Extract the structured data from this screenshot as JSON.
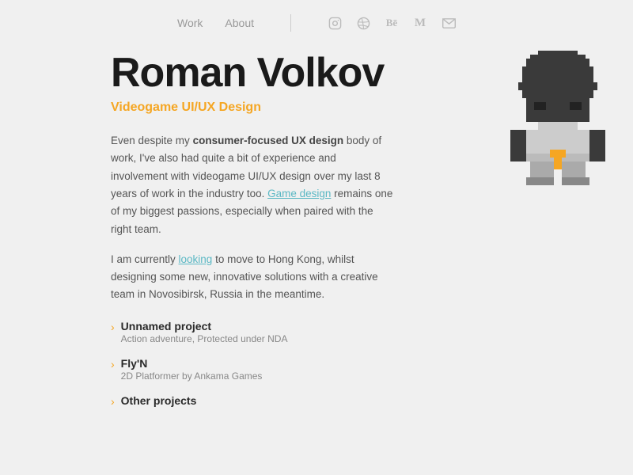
{
  "nav": {
    "links": [
      {
        "label": "Work",
        "id": "work"
      },
      {
        "label": "About",
        "id": "about"
      }
    ],
    "icons": [
      {
        "name": "instagram-icon",
        "symbol": "◯"
      },
      {
        "name": "dribbble-icon",
        "symbol": "◉"
      },
      {
        "name": "behance-icon",
        "symbol": "Bē"
      },
      {
        "name": "medium-icon",
        "symbol": "M"
      },
      {
        "name": "email-icon",
        "symbol": "✉"
      }
    ]
  },
  "hero": {
    "name": "Roman Volkov",
    "subtitle": "Videogame UI/UX Design",
    "description_1": "Even despite my consumer-focused UX design body of work, I've also had quite a bit of experience and involvement with videogame UI/UX design over my last 8 years of work in the industry too. Game design remains one of my biggest passions, especially when paired with the right team.",
    "game_design_link": "Game design",
    "description_2": "I am currently looking to move to Hong Kong, whilst designing some new, innovative solutions with a creative team in Novosibirsk, Russia in the meantime.",
    "looking_link": "looking"
  },
  "projects": [
    {
      "name": "Unnamed project",
      "sub": "Action adventure, Protected under NDA"
    },
    {
      "name": "Fly'N",
      "sub": "2D Platformer by Ankama Games"
    },
    {
      "name": "Other projects",
      "sub": ""
    }
  ],
  "chevron": "›"
}
